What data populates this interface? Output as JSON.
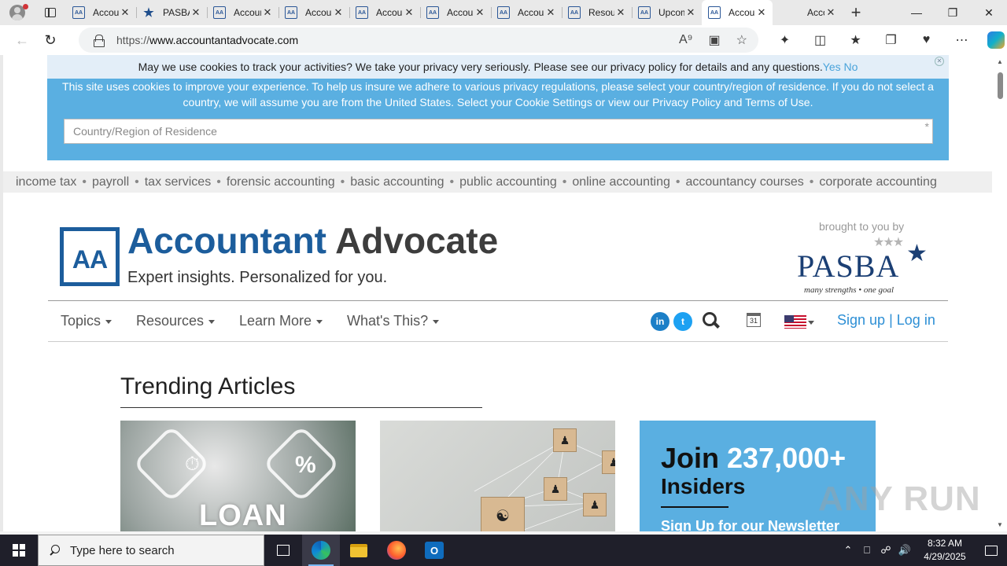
{
  "browser": {
    "tabs": [
      {
        "title": "Accountant Advocate",
        "icon": "aa-favicon",
        "active": false
      },
      {
        "title": "PASBA",
        "icon": "star-favicon",
        "active": false
      },
      {
        "title": "Accountant Advocate",
        "icon": "aa-favicon",
        "active": false
      },
      {
        "title": "Accountant Advocate",
        "icon": "aa-favicon",
        "active": false
      },
      {
        "title": "Accountant Advocate",
        "icon": "aa-favicon",
        "active": false
      },
      {
        "title": "Accountant Advocate",
        "icon": "aa-favicon",
        "active": false
      },
      {
        "title": "Accountant Advocate",
        "icon": "aa-favicon",
        "active": false
      },
      {
        "title": "Resources",
        "icon": "aa-favicon",
        "active": false
      },
      {
        "title": "Upcoming",
        "icon": "aa-favicon",
        "active": false
      },
      {
        "title": "Accountant Advocate",
        "icon": "aa-favicon",
        "active": true
      },
      {
        "title": "Accountant Advocate",
        "icon": "none",
        "active": false
      }
    ],
    "favicon_text": "AA",
    "url_prefix": "https://",
    "url_host": "www.accountantadvocate.com"
  },
  "cookie_notice": {
    "text": "May we use cookies to track your activities? We take your privacy very seriously. Please see our privacy policy for details and any questions.",
    "yes": "Yes",
    "no": "No",
    "region_text": "This site uses cookies to improve your experience. To help us insure we adhere to various privacy regulations, please select your country/region of residence. If you do not select a country, we will assume you are from the United States. Select your Cookie Settings or view our Privacy Policy and Terms of Use.",
    "country_placeholder": "Country/Region of Residence",
    "required_mark": "*"
  },
  "topics_bar": [
    "income tax",
    "payroll",
    "tax services",
    "forensic accounting",
    "basic accounting",
    "public accounting",
    "online accounting",
    "accountancy courses",
    "corporate accounting"
  ],
  "header": {
    "logo_letters": "AA",
    "brand_part1": "Accountant",
    "brand_part2": "Advocate",
    "tagline": "Expert insights. Personalized for you.",
    "brought_by": "brought to you by",
    "sponsor_name": "PASBA",
    "sponsor_motto": "many strengths • one goal"
  },
  "nav": {
    "items": [
      "Topics",
      "Resources",
      "Learn More",
      "What's This?"
    ],
    "linkedin": "in",
    "twitter": "t",
    "calendar_day": "31",
    "signup": "Sign up",
    "divider": "|",
    "login": "Log in"
  },
  "trending": {
    "title": "Trending Articles",
    "card1_text": "LOAN"
  },
  "newsletter": {
    "join": "Join",
    "count": "237,000+",
    "insiders": "Insiders",
    "signup": "Sign Up for our Newsletter"
  },
  "watermark": "ANY RUN",
  "taskbar": {
    "search_placeholder": "Type here to search",
    "time": "8:32 AM",
    "date": "4/29/2025"
  },
  "colors": {
    "brand_blue": "#1c5d9c",
    "cookie_blue": "#5aafe1",
    "link_blue": "#2d8fd5"
  }
}
